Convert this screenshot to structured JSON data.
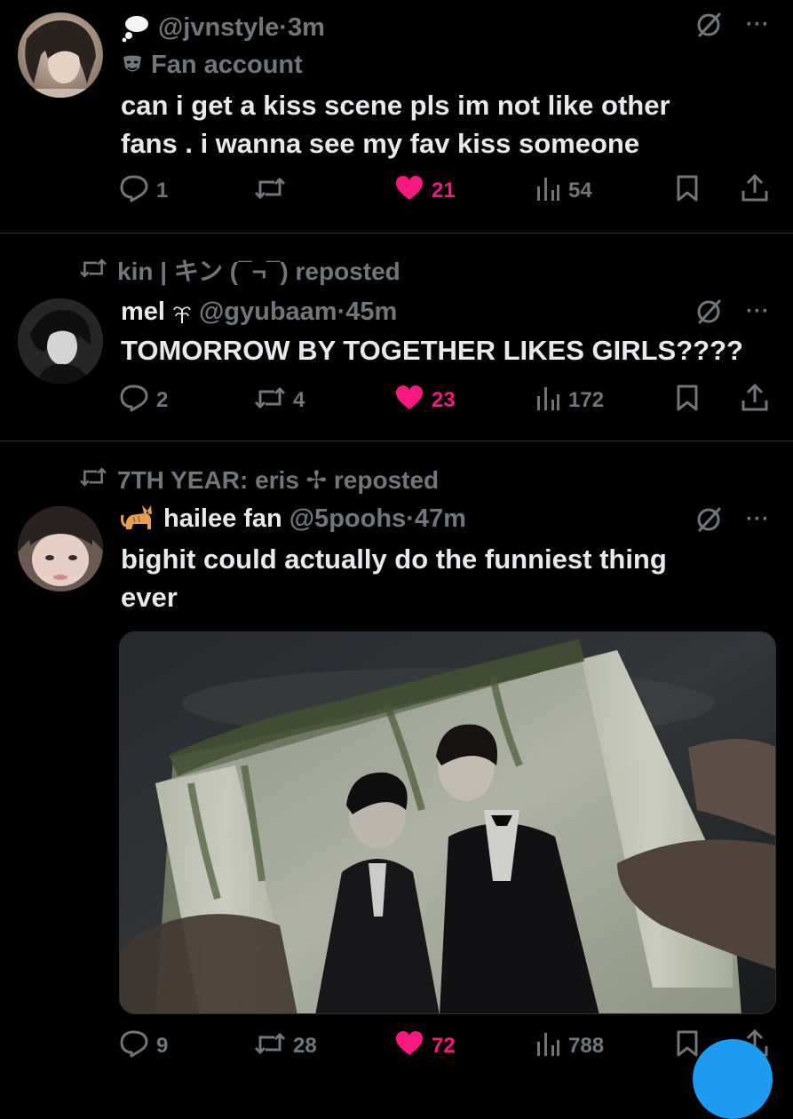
{
  "tweets": [
    {
      "display_name_icon": "thought-balloon-emoji",
      "handle": "@jvnstyle",
      "time": "·3m",
      "label": "Fan account",
      "text_lines": [
        "can i get a kiss scene pls im not like other",
        "fans . i wanna see my fav kiss someone"
      ],
      "replies": "1",
      "reposts": "",
      "likes": "21",
      "views": "54"
    },
    {
      "repost_by": "kin | キン (¯¬¯) reposted",
      "display_name": "mel",
      "name_icon": "sprout-glyph",
      "handle": "@gyubaam",
      "time": "·45m",
      "text_lines": [
        "TOMORROW BY TOGETHER LIKES GIRLS????"
      ],
      "replies": "2",
      "reposts": "4",
      "likes": "23",
      "views": "172"
    },
    {
      "repost_by": "7TH YEAR: eris ✢ reposted",
      "display_name_icon": "cat-emoji",
      "display_name": "hailee fan",
      "handle": "@5poohs",
      "time": "·47m",
      "text_lines": [
        "bighit could actually do the funniest thing",
        "ever"
      ],
      "replies": "9",
      "reposts": "28",
      "likes": "72",
      "views": "788"
    }
  ],
  "colors": {
    "background": "#000000",
    "text": "#e7e9ea",
    "muted": "#71767b",
    "like": "#f91880",
    "accent": "#1d9bf0"
  },
  "more": "···"
}
